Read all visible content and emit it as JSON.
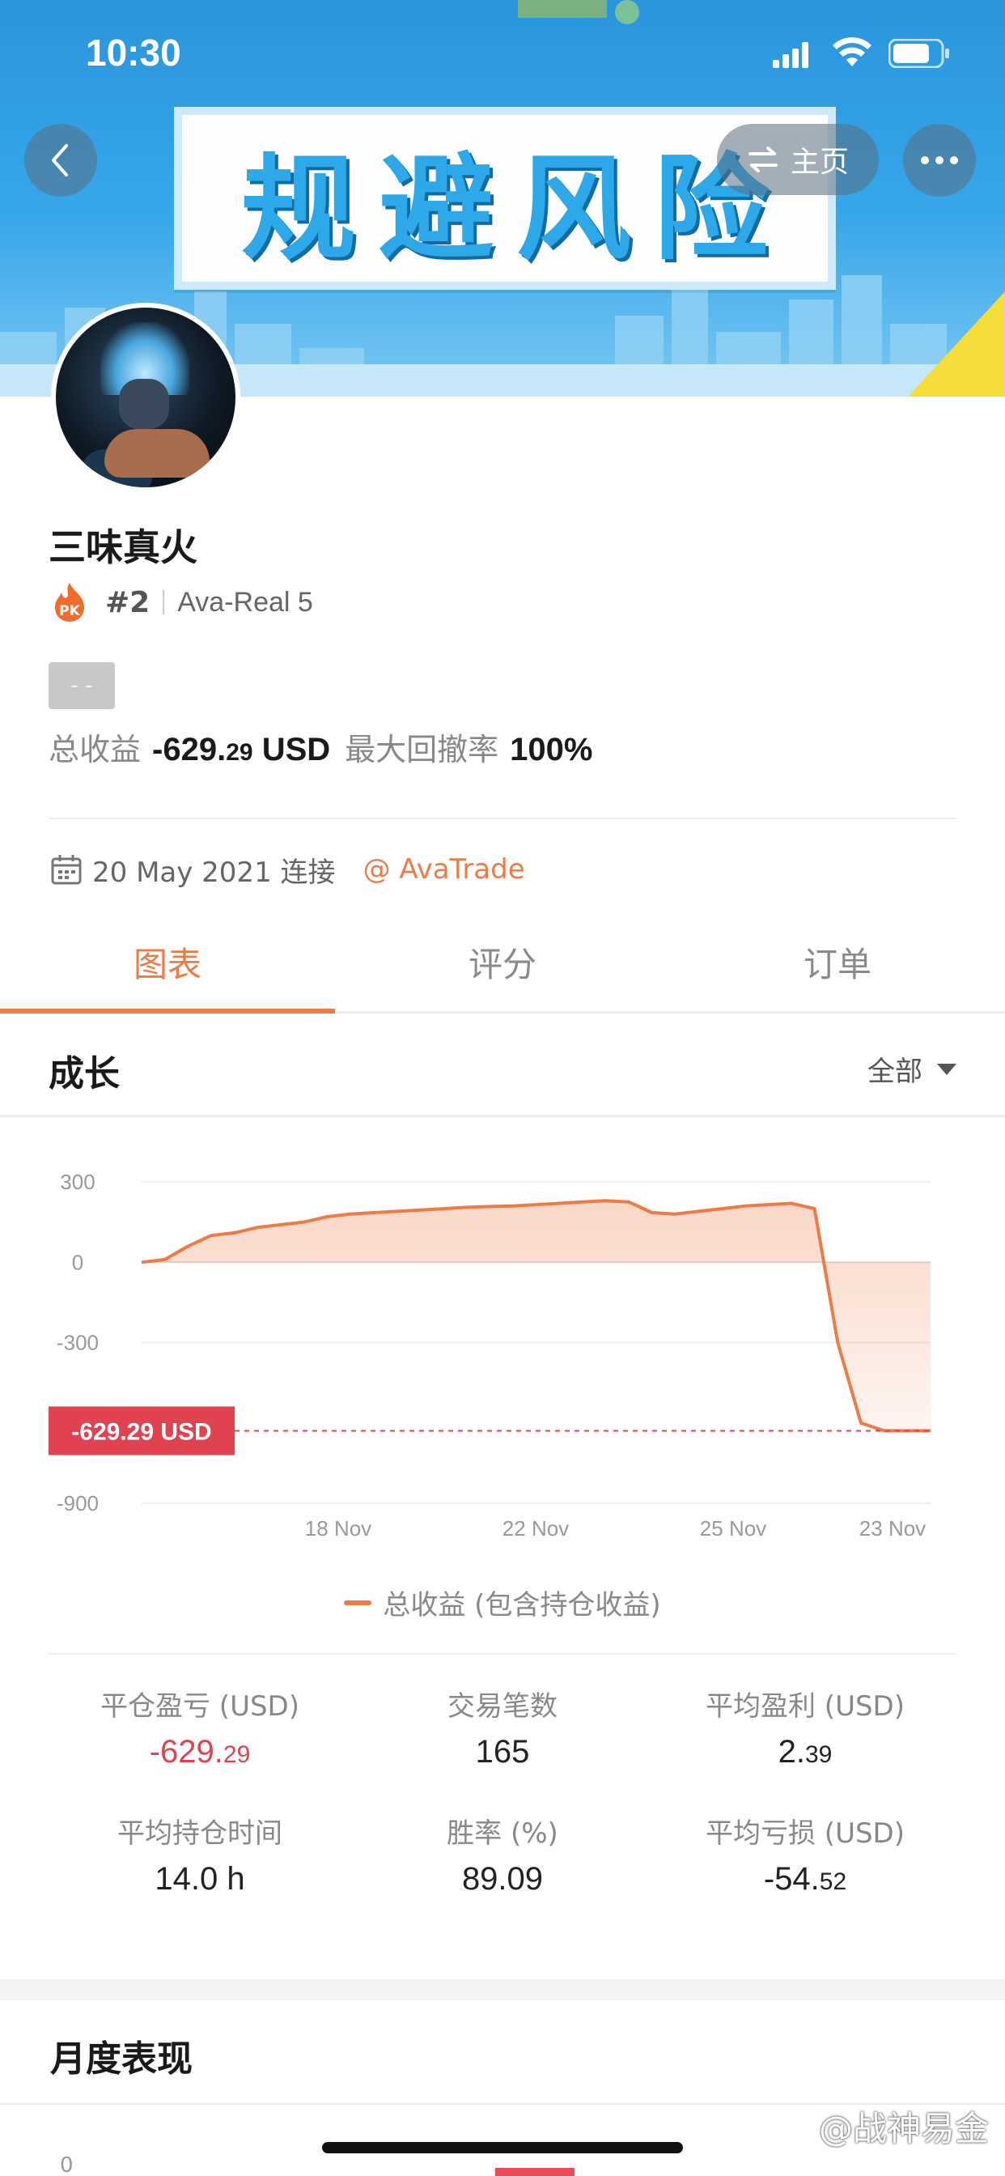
{
  "status_bar": {
    "time": "10:30"
  },
  "banner": {
    "title": "规避风险"
  },
  "nav": {
    "home_label": "主页"
  },
  "profile": {
    "name": "三味真火",
    "rank": "#2",
    "account": "Ava-Real 5",
    "tag": "- -",
    "total_return_label": "总收益",
    "total_return_value": "-629.",
    "total_return_decimals": "29",
    "total_return_unit": "USD",
    "max_drawdown_label": "最大回撤率",
    "max_drawdown_value": "100%",
    "connected_date": "20 May 2021 连接",
    "broker": "@ AvaTrade"
  },
  "tabs": [
    {
      "label": "图表",
      "active": true
    },
    {
      "label": "评分",
      "active": false
    },
    {
      "label": "订单",
      "active": false
    }
  ],
  "growth_section": {
    "title": "成长",
    "filter": "全部"
  },
  "chart_data": {
    "type": "area",
    "y_ticks": [
      "300",
      "0",
      "-300",
      "-900"
    ],
    "ylim": [
      -900,
      300
    ],
    "x_tick_labels": [
      "18 Nov",
      "22 Nov",
      "25 Nov",
      "23 Nov"
    ],
    "series": [
      {
        "name": "总收益 (包含持仓收益)",
        "color": "#ee7b45",
        "values": [
          0,
          10,
          60,
          100,
          110,
          130,
          140,
          150,
          170,
          180,
          185,
          190,
          195,
          200,
          205,
          208,
          210,
          215,
          220,
          225,
          230,
          225,
          185,
          180,
          190,
          200,
          210,
          215,
          220,
          200,
          -300,
          -600,
          -629.29,
          -629.29,
          -629.29
        ]
      }
    ],
    "current_value_label": "-629.29 USD",
    "current_value": -629.29,
    "legend": "总收益 (包含持仓收益)"
  },
  "metrics": [
    {
      "label": "平仓盈亏 (USD)",
      "main": "-629.",
      "dec": "29",
      "negative": true
    },
    {
      "label": "交易笔数",
      "main": "165",
      "dec": "",
      "negative": false
    },
    {
      "label": "平均盈利 (USD)",
      "main": "2.",
      "dec": "39",
      "negative": false
    },
    {
      "label": "平均持仓时间",
      "main": "14.0 h",
      "dec": "",
      "negative": false
    },
    {
      "label": "胜率 (%)",
      "main": "89.09",
      "dec": "",
      "negative": false
    },
    {
      "label": "平均亏损 (USD)",
      "main": "-54.",
      "dec": "52",
      "negative": false
    }
  ],
  "monthly": {
    "title": "月度表现",
    "zero_label": "0"
  },
  "watermark": {
    "text": "@战神易金"
  },
  "colors": {
    "accent": "#ee7b45",
    "negative": "#e0424f",
    "marker": "#e94b59"
  }
}
